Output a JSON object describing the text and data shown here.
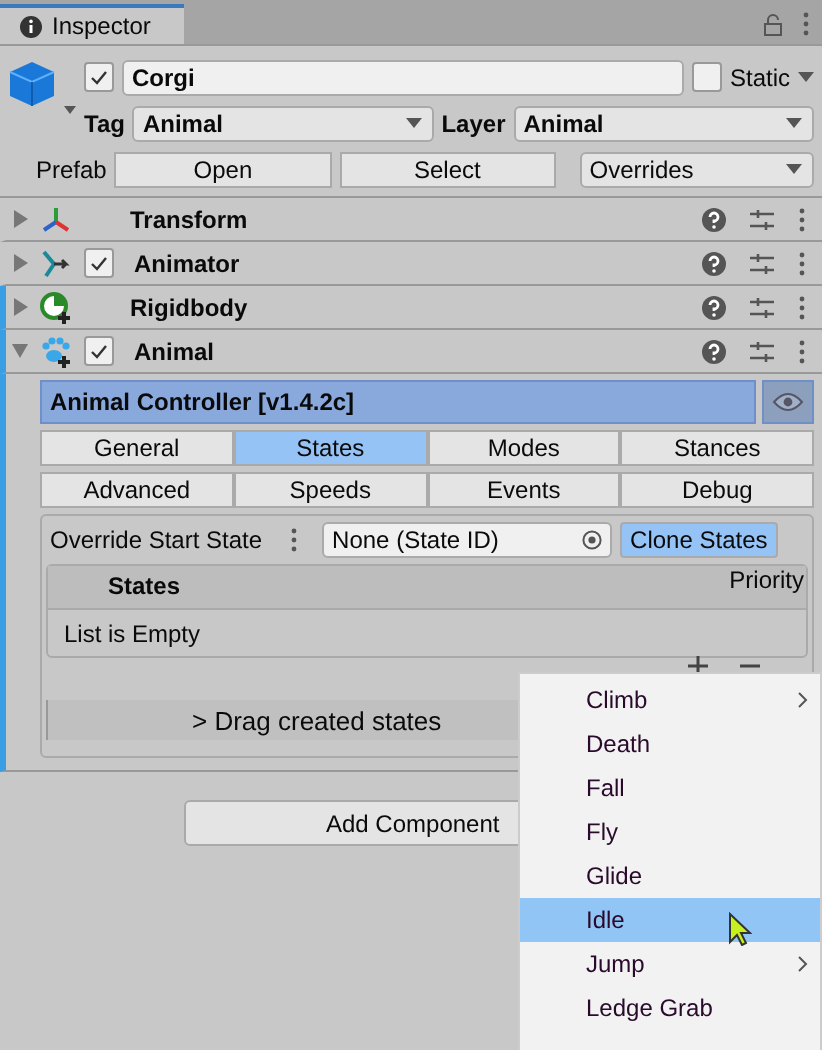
{
  "tab": {
    "title": "Inspector"
  },
  "object": {
    "active": true,
    "name": "Corgi",
    "static_label": "Static",
    "static": false,
    "tag_label": "Tag",
    "tag": "Animal",
    "layer_label": "Layer",
    "layer": "Animal",
    "prefab_label": "Prefab",
    "prefab_buttons": [
      "Open",
      "Select"
    ],
    "overrides": "Overrides"
  },
  "components": [
    {
      "name": "Transform",
      "kind": "transform",
      "expanded": false,
      "added": false
    },
    {
      "name": "Animator",
      "kind": "animator",
      "enabled": true,
      "expanded": false,
      "added": false
    },
    {
      "name": "Rigidbody",
      "kind": "rigidbody",
      "expanded": false,
      "added": true
    },
    {
      "name": "Animal",
      "kind": "paw",
      "enabled": true,
      "expanded": true,
      "added": true
    }
  ],
  "animal": {
    "title": "Animal Controller [v1.4.2c]",
    "tabs": [
      {
        "label": "General",
        "selected": false
      },
      {
        "label": "States",
        "selected": true
      },
      {
        "label": "Modes",
        "selected": false
      },
      {
        "label": "Stances",
        "selected": false
      },
      {
        "label": "Advanced",
        "selected": false
      },
      {
        "label": "Speeds",
        "selected": false
      },
      {
        "label": "Events",
        "selected": false
      },
      {
        "label": "Debug",
        "selected": false
      }
    ],
    "override_label": "Override Start State",
    "override_value": "None (State ID)",
    "clone_button": "Clone States",
    "list_title": "States",
    "priority": "Priority",
    "empty": "List is Empty",
    "drag_hint": "> Drag created states"
  },
  "add_component": "Add Component",
  "menu": [
    {
      "label": "Climb",
      "submenu": true,
      "selected": false
    },
    {
      "label": "Death",
      "submenu": false,
      "selected": false
    },
    {
      "label": "Fall",
      "submenu": false,
      "selected": false
    },
    {
      "label": "Fly",
      "submenu": false,
      "selected": false
    },
    {
      "label": "Glide",
      "submenu": false,
      "selected": false
    },
    {
      "label": "Idle",
      "submenu": false,
      "selected": true
    },
    {
      "label": "Jump",
      "submenu": true,
      "selected": false
    },
    {
      "label": "Ledge Grab",
      "submenu": false,
      "selected": false
    }
  ]
}
